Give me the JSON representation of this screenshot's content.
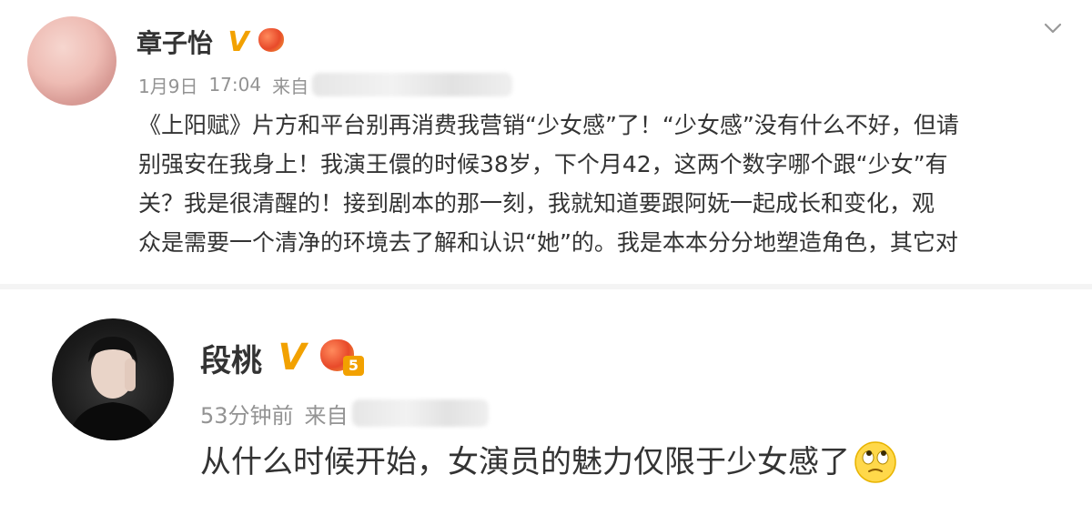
{
  "post1": {
    "username": "章子怡",
    "verified_badge": "V",
    "level": "",
    "icons": [
      "avatar",
      "verified-icon",
      "level-icon",
      "chevron-down-icon"
    ],
    "date": "1月9日",
    "time": "17:04",
    "source_prefix": "来自",
    "body_lines": [
      "《上阳赋》片方和平台别再消费我营销“少女感”了！“少女感”没有什么不好，但请",
      "别强安在我身上！我演王儇的时候38岁，下个月42，这两个数字哪个跟“少女”有",
      "关？我是很清醒的！接到剧本的那一刻，我就知道要跟阿妩一起成长和变化，观",
      "众是需要一个清净的环境去了解和认识“她”的。我是本本分分地塑造角色，其它对"
    ]
  },
  "post2": {
    "username": "段桃",
    "verified_badge": "V",
    "level": "5",
    "time_ago": "53分钟前",
    "source_prefix": "来自",
    "reply_text": "从什么时候开始，女演员的魅力仅限于少女感了",
    "emoji": "eye-roll-emoji"
  },
  "colors": {
    "vip_orange": "#f2a100",
    "meta_gray": "#939393",
    "text": "#333333"
  }
}
